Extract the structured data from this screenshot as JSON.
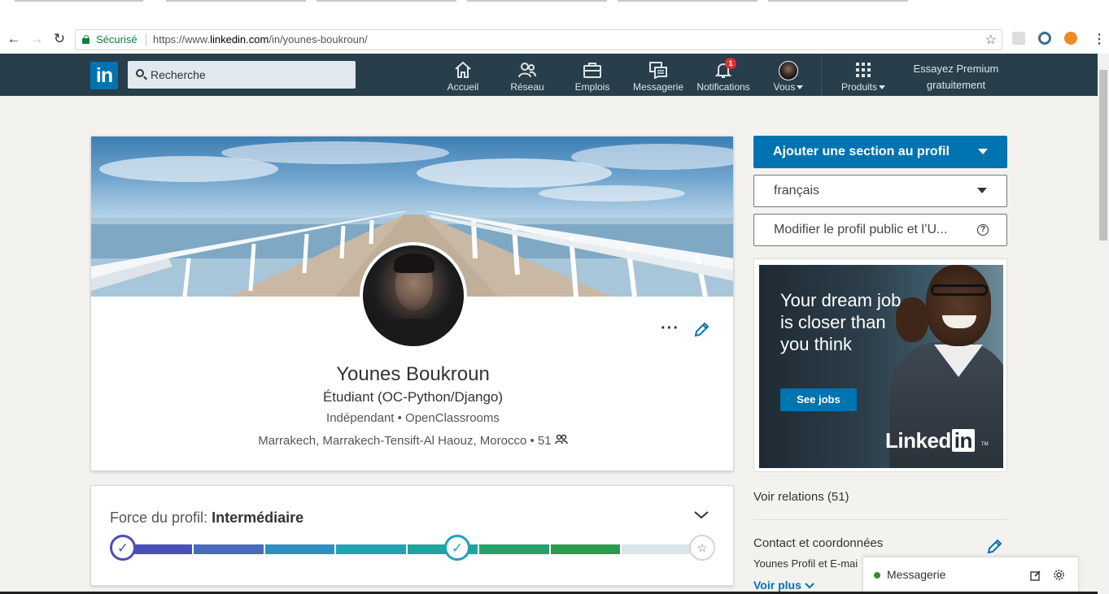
{
  "browser": {
    "secure_label": "Sécurisé",
    "url_prefix": "https://www.",
    "url_domain": "linkedin.com",
    "url_path": "/in/younes-boukroun/"
  },
  "nav": {
    "logo": "in",
    "search_placeholder": "Recherche",
    "items": [
      {
        "label": "Accueil",
        "icon": "home-icon"
      },
      {
        "label": "Réseau",
        "icon": "network-icon"
      },
      {
        "label": "Emplois",
        "icon": "briefcase-icon"
      },
      {
        "label": "Messagerie",
        "icon": "messaging-icon"
      },
      {
        "label": "Notifications",
        "icon": "bell-icon",
        "badge": "1"
      },
      {
        "label": "Vous",
        "icon": "avatar-icon"
      },
      {
        "label": "Produits",
        "icon": "grid-icon"
      }
    ],
    "premium_line1": "Essayez Premium",
    "premium_line2": "gratuitement"
  },
  "profile": {
    "name": "Younes Boukroun",
    "headline": "Étudiant (OC-Python/Django)",
    "work": "Indépendant • OpenClassrooms",
    "location": "Marrakech, Marrakech-Tensift-Al Haouz, Morocco • 51",
    "more_label": "···"
  },
  "strength": {
    "label": "Force du profil:",
    "level": "Intermédiaire",
    "progress_fraction": 0.6,
    "segment_colors": [
      "#4a4fb8",
      "#4a6cb8",
      "#2f8fbf",
      "#22a3b5",
      "#1ea59c",
      "#27a06b",
      "#2c9a4e",
      "#dbe5ea"
    ]
  },
  "rail": {
    "add_section": "Ajouter une section au profil",
    "language": "français",
    "public_profile": "Modifier le profil public et l’U...",
    "ad": {
      "text": "Your dream job is closer than you think",
      "button": "See jobs",
      "logo_text": "Linked",
      "logo_in": "in",
      "tm": "TM"
    },
    "connections": "Voir relations (51)",
    "contact_title": "Contact et coordonnées",
    "contact_sub": "Younes Profil et E-mai",
    "see_more": "Voir plus"
  },
  "messaging": {
    "label": "Messagerie"
  },
  "colors": {
    "brand": "#0073b1",
    "nav_bg": "#283e4a",
    "page_bg": "#f3f2ef"
  }
}
